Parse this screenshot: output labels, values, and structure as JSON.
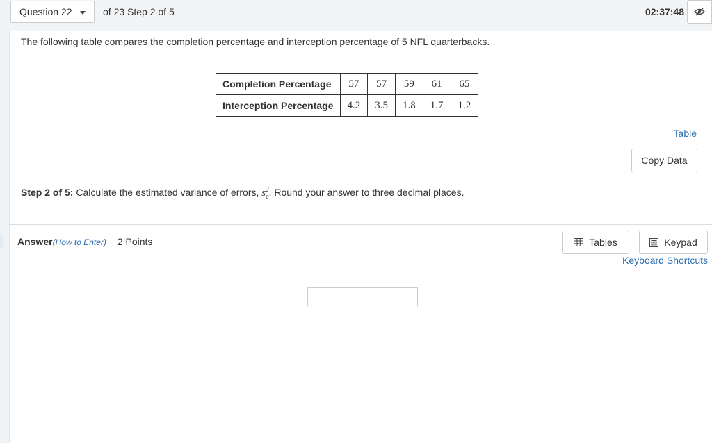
{
  "header": {
    "question_select": "Question 22",
    "progress": "of 23 Step 2 of 5",
    "timer": "02:37:48"
  },
  "problem": {
    "intro": "The following table compares the completion percentage and interception percentage of 5 NFL quarterbacks.",
    "table": {
      "rows": [
        {
          "label": "Completion Percentage",
          "values": [
            "57",
            "57",
            "59",
            "61",
            "65"
          ]
        },
        {
          "label": "Interception Percentage",
          "values": [
            "4.2",
            "3.5",
            "1.8",
            "1.7",
            "1.2"
          ]
        }
      ]
    },
    "table_link": "Table",
    "copy_data": "Copy Data",
    "step_label": "Step 2 of 5:",
    "step_text_1": "Calculate the estimated variance of errors,",
    "step_text_2": ". Round your answer to three decimal places."
  },
  "answer": {
    "label": "Answer",
    "how_to": "(How to Enter)",
    "points": "2 Points",
    "tables_button": "Tables",
    "keypad_button": "Keypad",
    "shortcuts_link": "Keyboard Shortcuts",
    "input_value": ""
  },
  "icons": [
    "chevron-down-icon",
    "eye-slash-icon",
    "table-icon",
    "keypad-icon"
  ]
}
